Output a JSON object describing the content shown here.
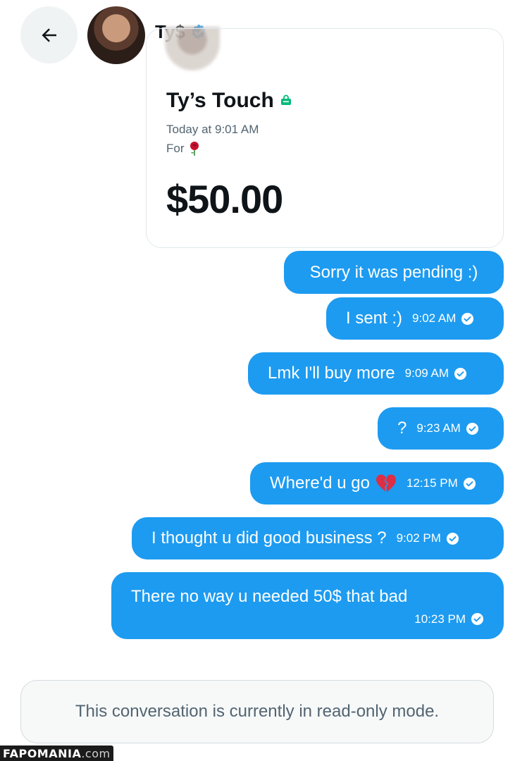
{
  "header": {
    "back_icon": "arrow-left-icon",
    "name": "Ty$",
    "verified_icon": "verified-badge-icon",
    "verified_color": "#1d9bf0"
  },
  "payment_card": {
    "title": "Ty’s Touch",
    "title_icon": "shop-bag-icon",
    "title_icon_color": "#00ba7c",
    "time": "Today at 9:01 AM",
    "for_label": "For",
    "for_icon": "rose-icon",
    "amount": "$50.00"
  },
  "messages": [
    {
      "text": "Sorry it was pending :)",
      "time": ""
    },
    {
      "text": "I sent :)",
      "time": "9:02 AM"
    },
    {
      "text": "Lmk I'll buy more",
      "time": "9:09 AM"
    },
    {
      "text": "?",
      "time": "9:23 AM"
    },
    {
      "text": "Where'd u go",
      "emoji_icon": "broken-heart-icon",
      "time": "12:15 PM"
    },
    {
      "text": "I thought u did good business ?",
      "time": "9:02 PM"
    },
    {
      "text": "There no way u needed 50$ that bad",
      "time": "10:23 PM"
    }
  ],
  "bubble_color": "#1d9bf0",
  "readonly_notice": "This conversation is currently in read-only mode.",
  "watermark": {
    "brand": "FAPOMANIA",
    "tld": ".com"
  }
}
